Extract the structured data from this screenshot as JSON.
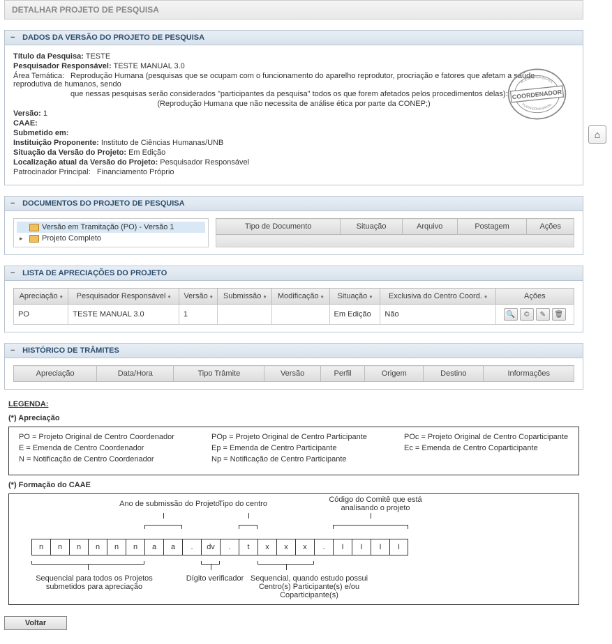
{
  "page_title": "DETALHAR PROJETO DE PESQUISA",
  "sections": {
    "dados": {
      "title": "DADOS DA VERSÃO DO PROJETO DE PESQUISA",
      "titulo_label": "Título da Pesquisa:",
      "titulo": "TESTE",
      "pesq_label": "Pesquisador Responsável:",
      "pesq": "TESTE MANUAL 3.0",
      "area_label": "Área Temática:",
      "area1": "Reprodução Humana (pesquisas que se ocupam com o funcionamento do aparelho reprodutor, procriação e fatores que afetam a saúde reprodutiva de humanos, sendo",
      "area2": "que nessas pesquisas serão considerados \"participantes da pesquisa\" todos os que forem afetados pelos procedimentos delas):",
      "area3": "(Reprodução Humana que não necessita de análise ética por parte da CONEP;)",
      "versao_label": "Versão:",
      "versao": "1",
      "caae_label": "CAAE:",
      "caae": "",
      "submetido_label": "Submetido em:",
      "submetido": "",
      "inst_label": "Instituição Proponente:",
      "inst": "Instituto de Ciências Humanas/UNB",
      "sit_label": "Situação da Versão do Projeto:",
      "sit": "Em Edição",
      "loc_label": "Localização atual da Versão do Projeto:",
      "loc": "Pesquisador Responsável",
      "patro_label": "Patrocinador Principal:",
      "patro": "Financiamento Próprio",
      "stamp_text": "COORDENADOR",
      "stamp_ring": "PLATAFORMA BRASIL"
    },
    "documentos": {
      "title": "DOCUMENTOS DO PROJETO DE PESQUISA",
      "tree": {
        "item1": "Versão em Tramitação (PO) - Versão 1",
        "item2": "Projeto Completo"
      },
      "headers": [
        "Tipo de Documento",
        "Situação",
        "Arquivo",
        "Postagem",
        "Ações"
      ]
    },
    "apreciacoes": {
      "title": "LISTA DE APRECIAÇÕES DO PROJETO",
      "headers": [
        "Apreciação",
        "Pesquisador Responsável",
        "Versão",
        "Submissão",
        "Modificação",
        "Situação",
        "Exclusiva do Centro Coord.",
        "Ações"
      ],
      "row": {
        "apreciacao": "PO",
        "pesquisador": "TESTE MANUAL 3.0",
        "versao": "1",
        "submissao": "",
        "modificacao": "",
        "situacao": "Em Edição",
        "exclusiva": "Não"
      }
    },
    "historico": {
      "title": "HISTÓRICO DE TRÂMITES",
      "headers": [
        "Apreciação",
        "Data/Hora",
        "Tipo Trâmite",
        "Versão",
        "Perfil",
        "Origem",
        "Destino",
        "Informações"
      ]
    }
  },
  "legend": {
    "title": "LEGENDA:",
    "apreciacao_title": "(*) Apreciação",
    "items": {
      "po": "PO = Projeto Original de Centro Coordenador",
      "e": "E = Emenda de Centro Coordenador",
      "n": "N = Notificação de Centro Coordenador",
      "pop": "POp = Projeto Original de Centro Participante",
      "ep": "Ep = Emenda de Centro Participante",
      "np": "Np = Notificação de Centro Participante",
      "poc": "POc = Projeto Original de Centro Coparticipante",
      "ec": "Ec = Emenda de Centro Coparticipante"
    },
    "caae_title": "(*) Formação do CAAE",
    "caae_labels": {
      "ano": "Ano de submissão do Projeto",
      "tipo": "Tipo do centro",
      "codigo": "Código do Comitê que está analisando o projeto",
      "sequencial": "Sequencial para todos os Projetos submetidos para apreciação",
      "digito": "Dígito verificador",
      "seq_centro": "Sequencial, quando estudo possui Centro(s) Participante(s) e/ou Coparticipante(s)"
    },
    "caae_cells": [
      "n",
      "n",
      "n",
      "n",
      "n",
      "n",
      "a",
      "a",
      ".",
      "dv",
      ".",
      "t",
      "x",
      "x",
      "x",
      ".",
      "I",
      "I",
      "I",
      "I"
    ]
  },
  "buttons": {
    "voltar": "Voltar"
  }
}
